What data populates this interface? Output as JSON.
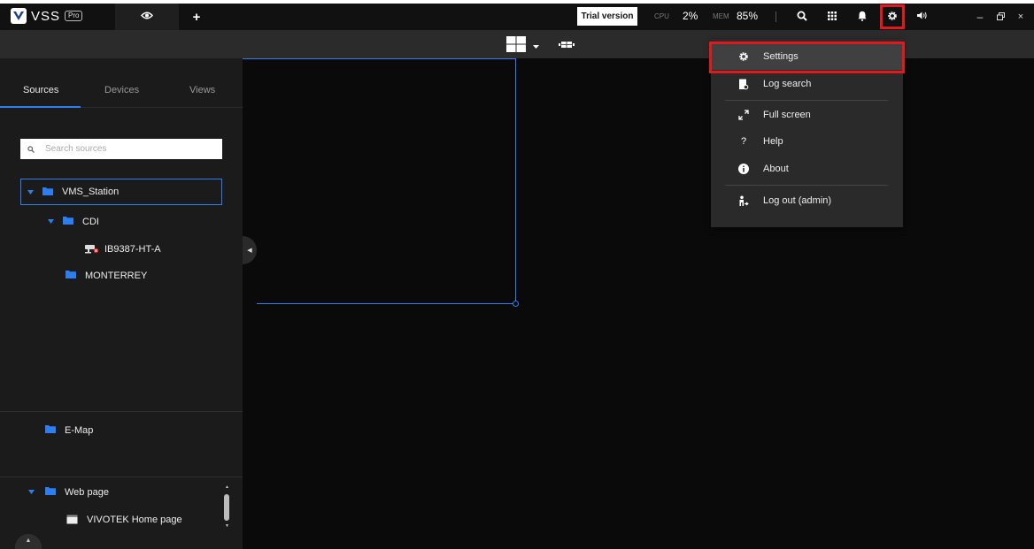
{
  "app": {
    "name": "VSS",
    "edition": "Pro"
  },
  "topbar": {
    "trial_label": "Trial version",
    "cpu_label": "CPU",
    "cpu_value": "2%",
    "mem_label": "MEM",
    "mem_value": "85%",
    "icons": [
      "eye-icon",
      "plus-icon",
      "search-icon",
      "apps-grid-icon",
      "bell-icon",
      "gear-icon",
      "speaker-icon",
      "minimize-icon",
      "restore-icon",
      "close-icon"
    ]
  },
  "left_panel": {
    "tabs": [
      {
        "label": "Sources",
        "active": true
      },
      {
        "label": "Devices",
        "active": false
      },
      {
        "label": "Views",
        "active": false
      }
    ],
    "search_placeholder": "Search sources",
    "tree": {
      "root": "VMS_Station",
      "group1": "CDI",
      "camera": "IB9387-HT-A",
      "group2": "MONTERREY"
    },
    "emap_label": "E-Map",
    "webpage": {
      "folder_label": "Web page",
      "item_label": "VIVOTEK Home page"
    }
  },
  "settings_menu": {
    "items": [
      {
        "label": "Settings",
        "icon": "gear-icon"
      },
      {
        "label": "Log search",
        "icon": "log-search-icon"
      },
      {
        "label": "Full screen",
        "icon": "fullscreen-icon"
      },
      {
        "label": "Help",
        "icon": "help-icon"
      },
      {
        "label": "About",
        "icon": "info-icon"
      },
      {
        "label": "Log out (admin)",
        "icon": "logout-icon"
      }
    ]
  },
  "colors": {
    "accent": "#2d7ef0",
    "highlight": "#e3181c",
    "background": "#0a0a0a",
    "panel": "#1b1b1b",
    "menu": "#2a2a2a"
  }
}
